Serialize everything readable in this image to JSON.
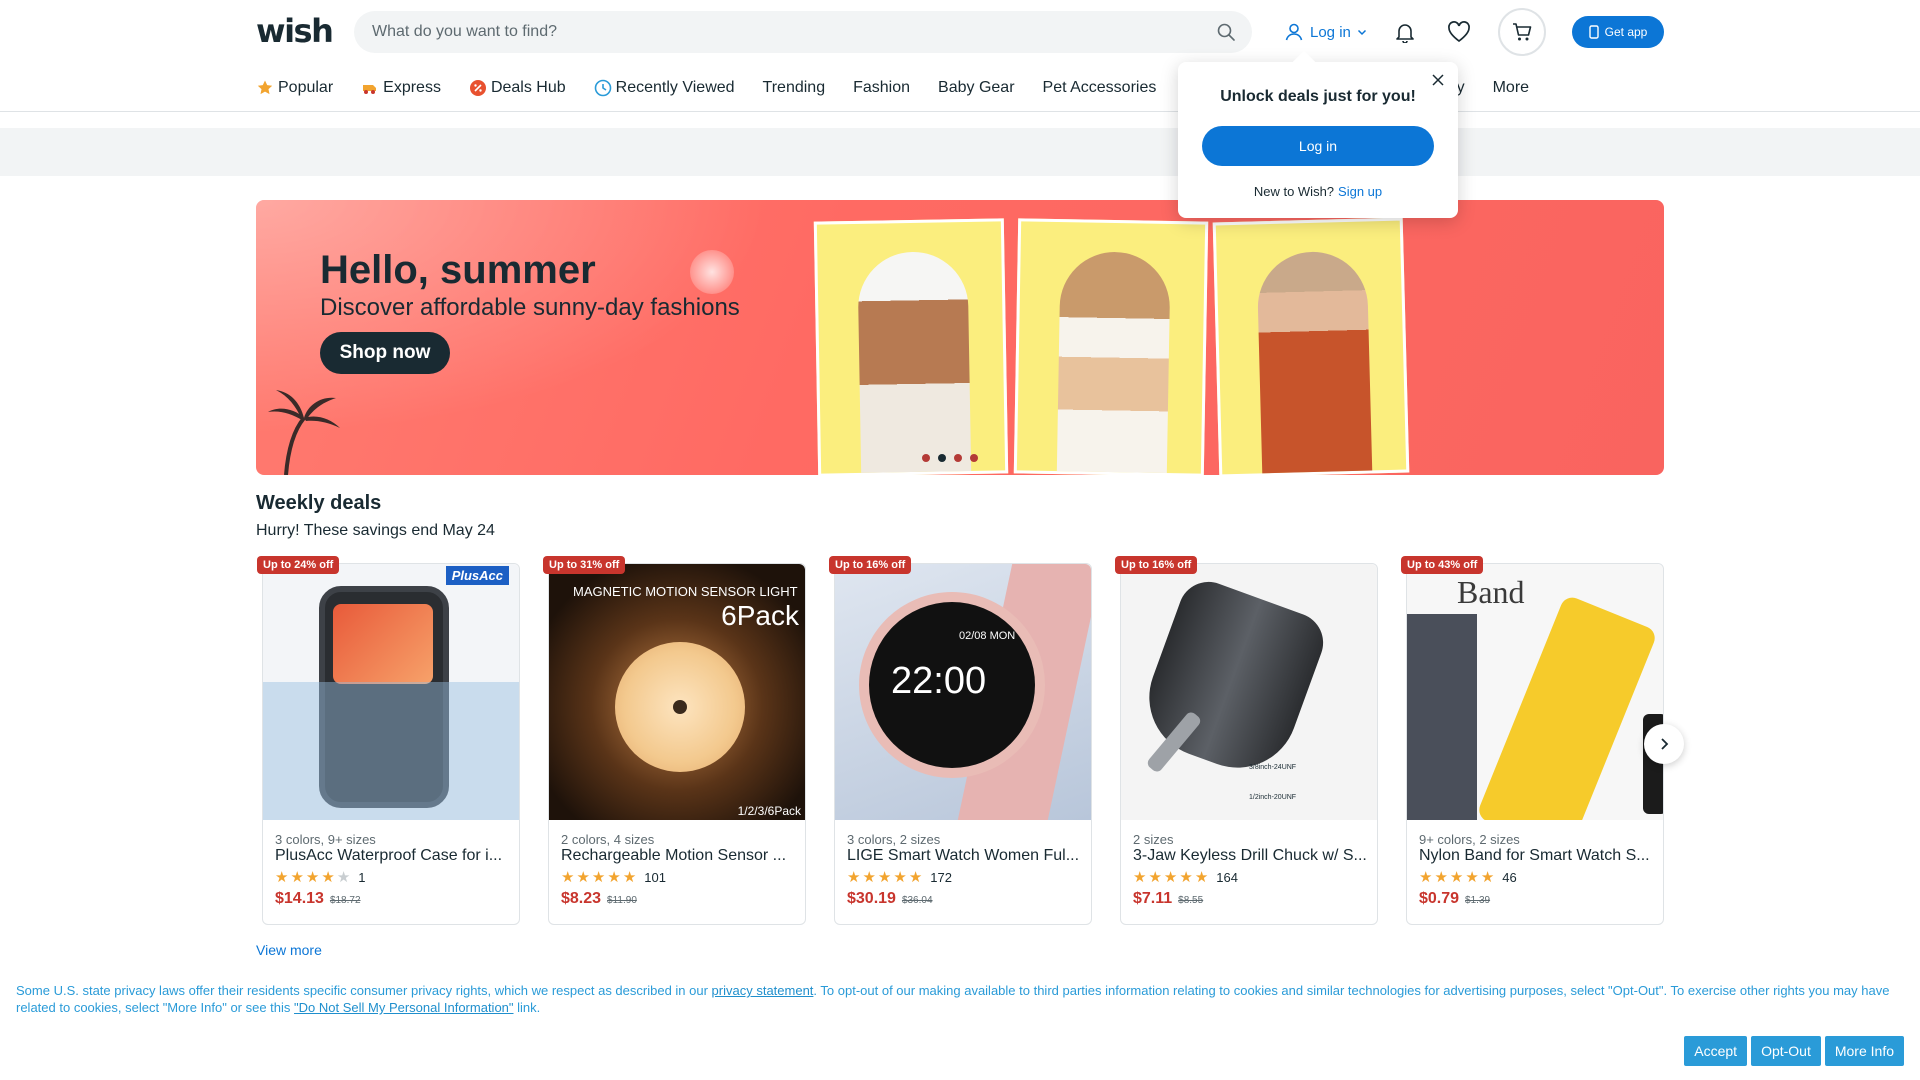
{
  "header": {
    "logo": "wish",
    "search_placeholder": "What do you want to find?",
    "login_label": "Log in",
    "get_app_label": "Get app",
    "colors": {
      "accent": "#0c76d6",
      "text": "#192a32"
    }
  },
  "nav": {
    "items": [
      {
        "label": "Popular",
        "icon": "star-icon"
      },
      {
        "label": "Express",
        "icon": "express-icon"
      },
      {
        "label": "Deals Hub",
        "icon": "deals-icon"
      },
      {
        "label": "Recently Viewed",
        "icon": "clock-icon"
      },
      {
        "label": "Trending"
      },
      {
        "label": "Fashion"
      },
      {
        "label": "Baby Gear"
      },
      {
        "label": "Pet Accessories"
      },
      {
        "label": "auty"
      },
      {
        "label": "More"
      }
    ]
  },
  "popup": {
    "title": "Unlock deals just for you!",
    "login_button": "Log in",
    "new_text": "New to Wish?",
    "signup_link": "Sign up"
  },
  "banner": {
    "title": "Hello, summer",
    "subtitle": "Discover affordable sunny-day fashions",
    "cta": "Shop now",
    "slide_count": 4,
    "active_slide": 2,
    "color": "#ff6a63"
  },
  "weekly": {
    "title": "Weekly deals",
    "subtitle": "Hurry! These savings end May 24",
    "view_more": "View more",
    "products": [
      {
        "badge": "Up to 24% off",
        "variants": "3 colors, 9+ sizes",
        "name": "PlusAcc Waterproof Case for i...",
        "rating": 4,
        "reviews": "1",
        "price": "$14.13",
        "was": "$18.72",
        "brand": "PlusAcc"
      },
      {
        "badge": "Up to 31% off",
        "variants": "2 colors, 4 sizes",
        "name": "Rechargeable Motion Sensor ...",
        "rating": 4.5,
        "reviews": "101",
        "price": "$8.23",
        "was": "$11.90",
        "img_title": "MAGNETIC MOTION SENSOR LIGHT",
        "img_pack": "6Pack",
        "img_corner": "1/2/3/6Pack"
      },
      {
        "badge": "Up to 16% off",
        "variants": "3 colors, 2 sizes",
        "name": "LIGE Smart Watch Women Ful...",
        "rating": 4.5,
        "reviews": "172",
        "price": "$30.19",
        "was": "$36.04",
        "img_time": "22:00",
        "img_date": "02/08 MON"
      },
      {
        "badge": "Up to 16% off",
        "variants": "2 sizes",
        "name": "3-Jaw Keyless Drill Chuck w/ S...",
        "rating": 4.5,
        "reviews": "164",
        "price": "$7.11",
        "was": "$8.55",
        "img_spec1": "3/8inch-24UNF",
        "img_spec2": "1/2inch-20UNF"
      },
      {
        "badge": "Up to 43% off",
        "variants": "9+ colors, 2 sizes",
        "name": "Nylon Band for Smart Watch S...",
        "rating": 4.5,
        "reviews": "46",
        "price": "$0.79",
        "was": "$1.39",
        "img_band": "Band"
      }
    ]
  },
  "cookie": {
    "text1": "Some U.S. state privacy laws offer their residents specific consumer privacy rights, which we respect as described in our ",
    "link1": "privacy statement",
    "text2": ". To opt-out of our making available to third parties information relating to cookies and similar technologies for advertising purposes, select \"Opt-Out\". To exercise other rights you may have related to cookies, select \"More Info\" or see this ",
    "link2": "\"Do Not Sell My Personal Information\"",
    "text3": " link.",
    "accept": "Accept",
    "optout": "Opt-Out",
    "moreinfo": "More Info"
  }
}
